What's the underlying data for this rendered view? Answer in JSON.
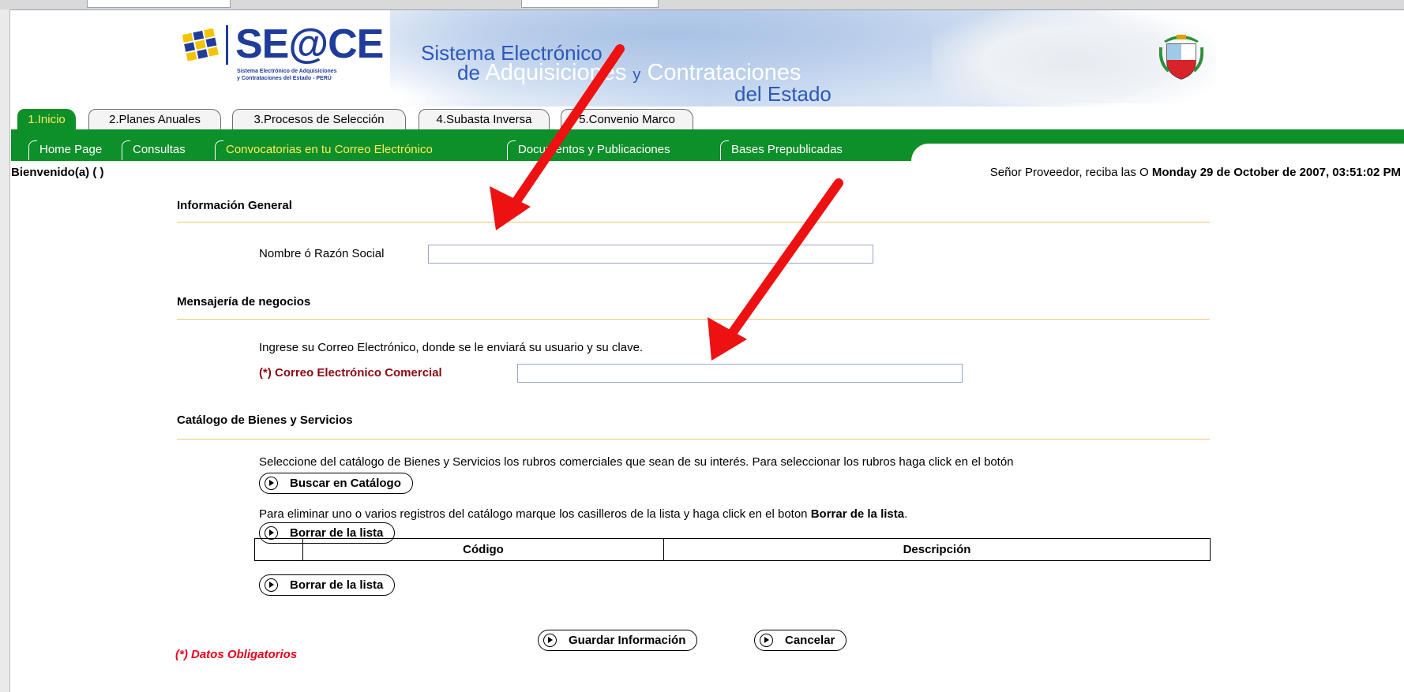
{
  "header": {
    "logo_text": "SE@CE",
    "logo_subtitle_1": "Sistema Electrónico de Adquisiciones",
    "logo_subtitle_2": "y Contrataciones del Estado - PERÚ",
    "system_line_1": "Sistema Electrónico",
    "system_line_2_de": "de",
    "system_line_2_word": "Adquisiciones",
    "system_line_2_y": "y",
    "system_line_2_word2": "Contrataciones",
    "system_line_3": "del Estado"
  },
  "tabs": [
    {
      "label": "1.Inicio",
      "active": true
    },
    {
      "label": "2.Planes Anuales",
      "active": false
    },
    {
      "label": "3.Procesos de Selección",
      "active": false
    },
    {
      "label": "4.Subasta Inversa",
      "active": false
    },
    {
      "label": "5.Convenio Marco",
      "active": false
    }
  ],
  "subnav": [
    {
      "label": "Home Page",
      "highlight": false
    },
    {
      "label": "Consultas",
      "highlight": false
    },
    {
      "label": "Convocatorias en tu Correo Electrónico",
      "highlight": true
    },
    {
      "label": "Documentos y Publicaciones",
      "highlight": false
    },
    {
      "label": "Bases Prepublicadas",
      "highlight": false
    }
  ],
  "status": {
    "welcome": "Bienvenido(a) ( )",
    "message": "Señor Proveedor, reciba las O",
    "datetime": "Monday 29 de October de 2007, 03:51:02 PM"
  },
  "general": {
    "title": "Información General",
    "name_label": "Nombre ó Razón Social",
    "name_value": ""
  },
  "messaging": {
    "title": "Mensajería de negocios",
    "instruction": "Ingrese su Correo Electrónico, donde se le enviará su usuario y su clave.",
    "email_label": "(*) Correo Electrónico Comercial",
    "email_value": ""
  },
  "catalog": {
    "title": "Catálogo de Bienes y Servicios",
    "instruction_select": "Seleccione del catálogo de Bienes y Servicios  los rubros comerciales que sean de su interés. Para seleccionar los rubros haga click en el botón",
    "search_button": "Buscar en Catálogo",
    "instruction_delete_prefix": "Para eliminar uno o varios registros del catálogo marque los casilleros de la lista y haga click en el boton ",
    "instruction_delete_bold": "Borrar de la lista",
    "instruction_delete_suffix": ".",
    "delete_button": "Borrar de la lista",
    "columns": [
      "",
      "Código",
      "Descripción"
    ]
  },
  "actions": {
    "save": "Guardar Información",
    "cancel": "Cancelar"
  },
  "footer_note": "(*) Datos Obligatorios",
  "colors": {
    "nav_green": "#0d8f2a",
    "nav_highlight": "#ffec5a",
    "required_red": "#8b0a12",
    "note_red": "#e3001b",
    "annotation_arrow": "#ee1111"
  }
}
